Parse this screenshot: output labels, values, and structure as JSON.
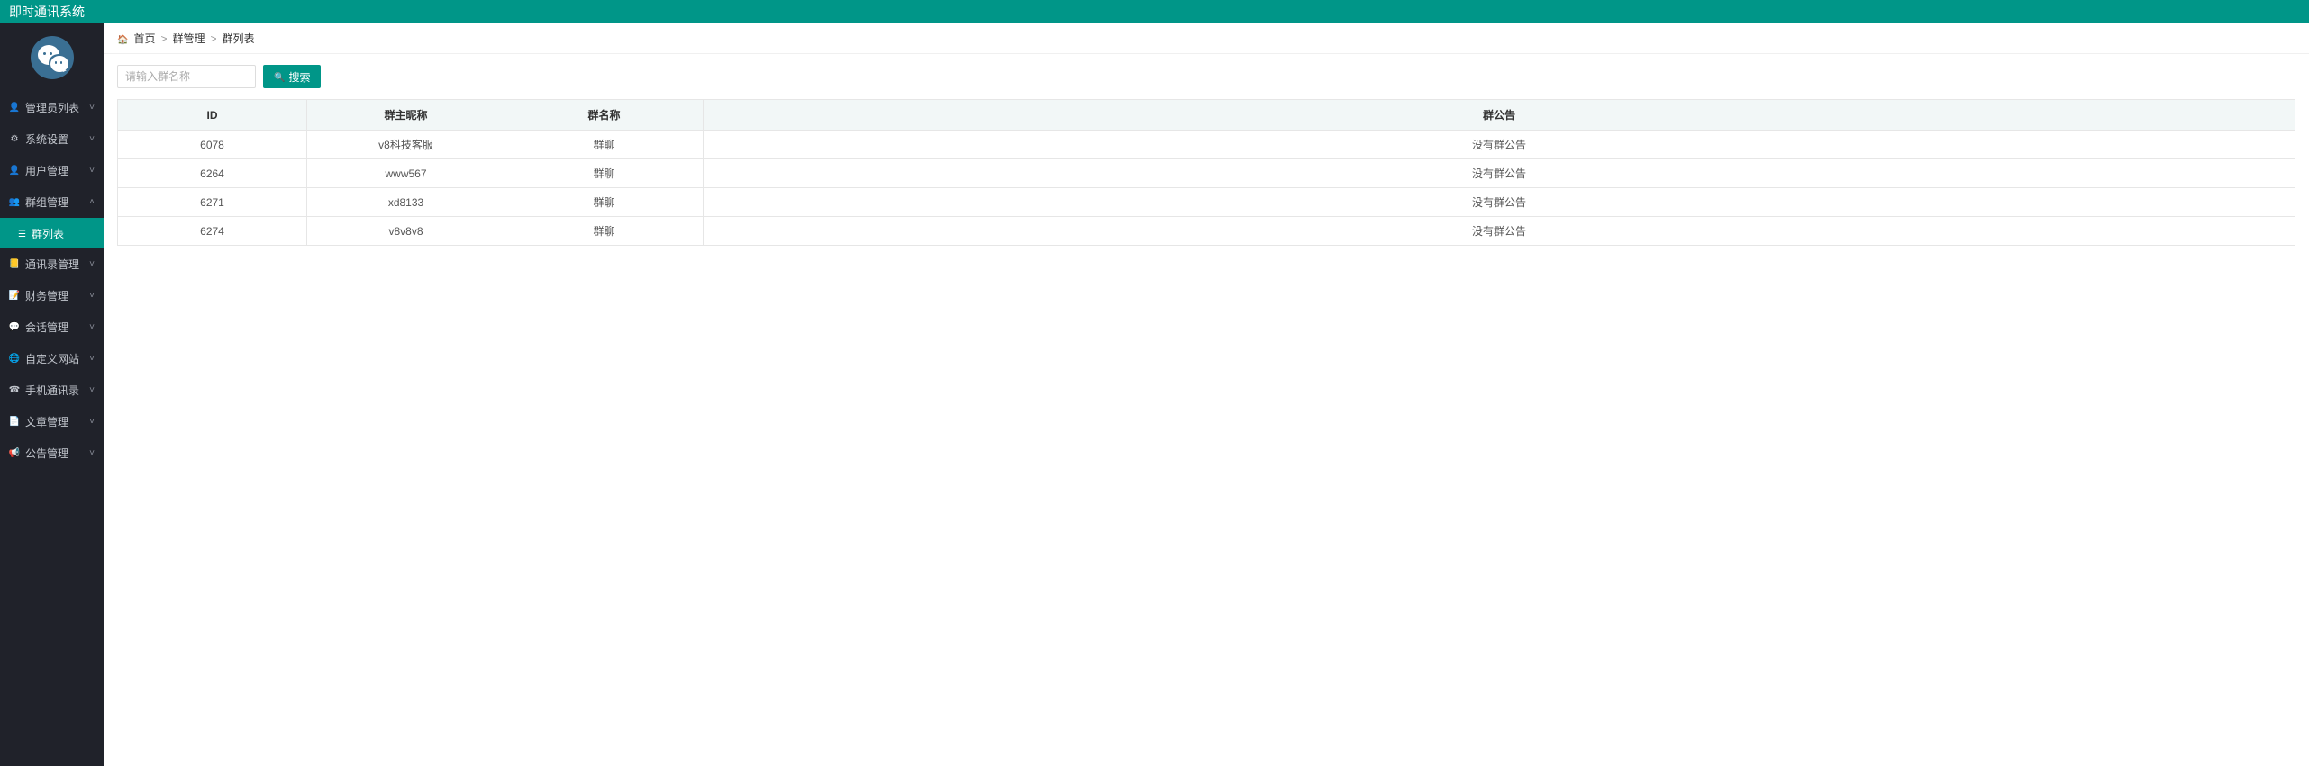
{
  "header": {
    "title": "即时通讯系统"
  },
  "sidebar": {
    "items": [
      {
        "label": "管理员列表",
        "icon": "i-user",
        "expanded": false
      },
      {
        "label": "系统设置",
        "icon": "i-gear",
        "expanded": false
      },
      {
        "label": "用户管理",
        "icon": "i-user",
        "expanded": false
      },
      {
        "label": "群组管理",
        "icon": "i-users",
        "expanded": true,
        "children": [
          {
            "label": "群列表",
            "icon": "i-list",
            "active": true
          }
        ]
      },
      {
        "label": "通讯录管理",
        "icon": "i-book",
        "expanded": false
      },
      {
        "label": "财务管理",
        "icon": "i-edit",
        "expanded": false
      },
      {
        "label": "会话管理",
        "icon": "i-chat",
        "expanded": false
      },
      {
        "label": "自定义网站",
        "icon": "i-globe",
        "expanded": false
      },
      {
        "label": "手机通讯录",
        "icon": "i-phone",
        "expanded": false
      },
      {
        "label": "文章管理",
        "icon": "i-doc",
        "expanded": false
      },
      {
        "label": "公告管理",
        "icon": "i-horn",
        "expanded": false
      }
    ]
  },
  "breadcrumb": {
    "home": "首页",
    "sep": ">",
    "items": [
      "群管理",
      "群列表"
    ]
  },
  "search": {
    "placeholder": "请输入群名称",
    "value": "",
    "button": "搜索"
  },
  "table": {
    "headers": [
      "ID",
      "群主昵称",
      "群名称",
      "群公告"
    ],
    "rows": [
      {
        "id": "6078",
        "owner": "v8科技客服",
        "name": "群聊",
        "notice": "没有群公告"
      },
      {
        "id": "6264",
        "owner": "www567",
        "name": "群聊",
        "notice": "没有群公告"
      },
      {
        "id": "6271",
        "owner": "xd8133",
        "name": "群聊",
        "notice": "没有群公告"
      },
      {
        "id": "6274",
        "owner": "v8v8v8",
        "name": "群聊",
        "notice": "没有群公告"
      }
    ]
  }
}
